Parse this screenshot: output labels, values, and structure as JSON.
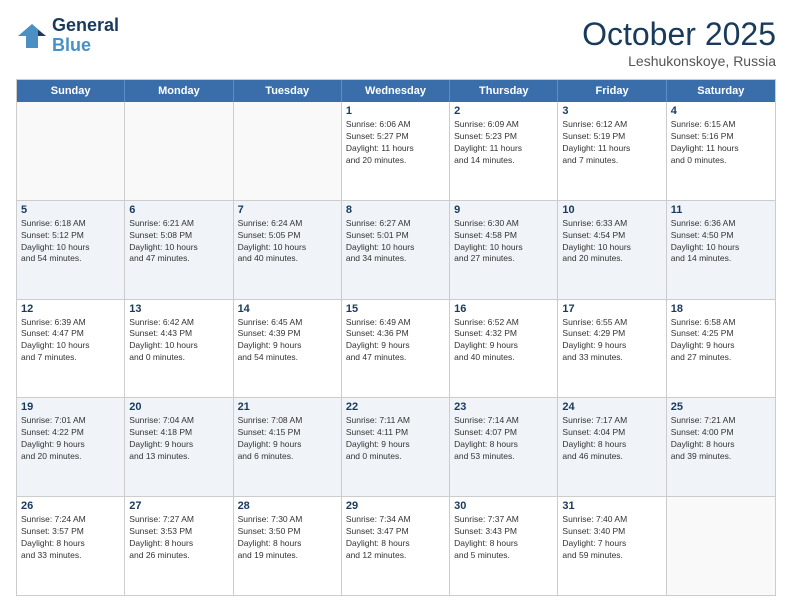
{
  "logo": {
    "line1": "General",
    "line2": "Blue"
  },
  "title": "October 2025",
  "location": "Leshukonskoye, Russia",
  "header_days": [
    "Sunday",
    "Monday",
    "Tuesday",
    "Wednesday",
    "Thursday",
    "Friday",
    "Saturday"
  ],
  "rows": [
    [
      {
        "day": "",
        "text": "",
        "empty": true
      },
      {
        "day": "",
        "text": "",
        "empty": true
      },
      {
        "day": "",
        "text": "",
        "empty": true
      },
      {
        "day": "1",
        "text": "Sunrise: 6:06 AM\nSunset: 5:27 PM\nDaylight: 11 hours\nand 20 minutes.",
        "empty": false
      },
      {
        "day": "2",
        "text": "Sunrise: 6:09 AM\nSunset: 5:23 PM\nDaylight: 11 hours\nand 14 minutes.",
        "empty": false
      },
      {
        "day": "3",
        "text": "Sunrise: 6:12 AM\nSunset: 5:19 PM\nDaylight: 11 hours\nand 7 minutes.",
        "empty": false
      },
      {
        "day": "4",
        "text": "Sunrise: 6:15 AM\nSunset: 5:16 PM\nDaylight: 11 hours\nand 0 minutes.",
        "empty": false
      }
    ],
    [
      {
        "day": "5",
        "text": "Sunrise: 6:18 AM\nSunset: 5:12 PM\nDaylight: 10 hours\nand 54 minutes.",
        "empty": false,
        "shaded": true
      },
      {
        "day": "6",
        "text": "Sunrise: 6:21 AM\nSunset: 5:08 PM\nDaylight: 10 hours\nand 47 minutes.",
        "empty": false,
        "shaded": true
      },
      {
        "day": "7",
        "text": "Sunrise: 6:24 AM\nSunset: 5:05 PM\nDaylight: 10 hours\nand 40 minutes.",
        "empty": false,
        "shaded": true
      },
      {
        "day": "8",
        "text": "Sunrise: 6:27 AM\nSunset: 5:01 PM\nDaylight: 10 hours\nand 34 minutes.",
        "empty": false,
        "shaded": true
      },
      {
        "day": "9",
        "text": "Sunrise: 6:30 AM\nSunset: 4:58 PM\nDaylight: 10 hours\nand 27 minutes.",
        "empty": false,
        "shaded": true
      },
      {
        "day": "10",
        "text": "Sunrise: 6:33 AM\nSunset: 4:54 PM\nDaylight: 10 hours\nand 20 minutes.",
        "empty": false,
        "shaded": true
      },
      {
        "day": "11",
        "text": "Sunrise: 6:36 AM\nSunset: 4:50 PM\nDaylight: 10 hours\nand 14 minutes.",
        "empty": false,
        "shaded": true
      }
    ],
    [
      {
        "day": "12",
        "text": "Sunrise: 6:39 AM\nSunset: 4:47 PM\nDaylight: 10 hours\nand 7 minutes.",
        "empty": false
      },
      {
        "day": "13",
        "text": "Sunrise: 6:42 AM\nSunset: 4:43 PM\nDaylight: 10 hours\nand 0 minutes.",
        "empty": false
      },
      {
        "day": "14",
        "text": "Sunrise: 6:45 AM\nSunset: 4:39 PM\nDaylight: 9 hours\nand 54 minutes.",
        "empty": false
      },
      {
        "day": "15",
        "text": "Sunrise: 6:49 AM\nSunset: 4:36 PM\nDaylight: 9 hours\nand 47 minutes.",
        "empty": false
      },
      {
        "day": "16",
        "text": "Sunrise: 6:52 AM\nSunset: 4:32 PM\nDaylight: 9 hours\nand 40 minutes.",
        "empty": false
      },
      {
        "day": "17",
        "text": "Sunrise: 6:55 AM\nSunset: 4:29 PM\nDaylight: 9 hours\nand 33 minutes.",
        "empty": false
      },
      {
        "day": "18",
        "text": "Sunrise: 6:58 AM\nSunset: 4:25 PM\nDaylight: 9 hours\nand 27 minutes.",
        "empty": false
      }
    ],
    [
      {
        "day": "19",
        "text": "Sunrise: 7:01 AM\nSunset: 4:22 PM\nDaylight: 9 hours\nand 20 minutes.",
        "empty": false,
        "shaded": true
      },
      {
        "day": "20",
        "text": "Sunrise: 7:04 AM\nSunset: 4:18 PM\nDaylight: 9 hours\nand 13 minutes.",
        "empty": false,
        "shaded": true
      },
      {
        "day": "21",
        "text": "Sunrise: 7:08 AM\nSunset: 4:15 PM\nDaylight: 9 hours\nand 6 minutes.",
        "empty": false,
        "shaded": true
      },
      {
        "day": "22",
        "text": "Sunrise: 7:11 AM\nSunset: 4:11 PM\nDaylight: 9 hours\nand 0 minutes.",
        "empty": false,
        "shaded": true
      },
      {
        "day": "23",
        "text": "Sunrise: 7:14 AM\nSunset: 4:07 PM\nDaylight: 8 hours\nand 53 minutes.",
        "empty": false,
        "shaded": true
      },
      {
        "day": "24",
        "text": "Sunrise: 7:17 AM\nSunset: 4:04 PM\nDaylight: 8 hours\nand 46 minutes.",
        "empty": false,
        "shaded": true
      },
      {
        "day": "25",
        "text": "Sunrise: 7:21 AM\nSunset: 4:00 PM\nDaylight: 8 hours\nand 39 minutes.",
        "empty": false,
        "shaded": true
      }
    ],
    [
      {
        "day": "26",
        "text": "Sunrise: 7:24 AM\nSunset: 3:57 PM\nDaylight: 8 hours\nand 33 minutes.",
        "empty": false
      },
      {
        "day": "27",
        "text": "Sunrise: 7:27 AM\nSunset: 3:53 PM\nDaylight: 8 hours\nand 26 minutes.",
        "empty": false
      },
      {
        "day": "28",
        "text": "Sunrise: 7:30 AM\nSunset: 3:50 PM\nDaylight: 8 hours\nand 19 minutes.",
        "empty": false
      },
      {
        "day": "29",
        "text": "Sunrise: 7:34 AM\nSunset: 3:47 PM\nDaylight: 8 hours\nand 12 minutes.",
        "empty": false
      },
      {
        "day": "30",
        "text": "Sunrise: 7:37 AM\nSunset: 3:43 PM\nDaylight: 8 hours\nand 5 minutes.",
        "empty": false
      },
      {
        "day": "31",
        "text": "Sunrise: 7:40 AM\nSunset: 3:40 PM\nDaylight: 7 hours\nand 59 minutes.",
        "empty": false
      },
      {
        "day": "",
        "text": "",
        "empty": true
      }
    ]
  ]
}
